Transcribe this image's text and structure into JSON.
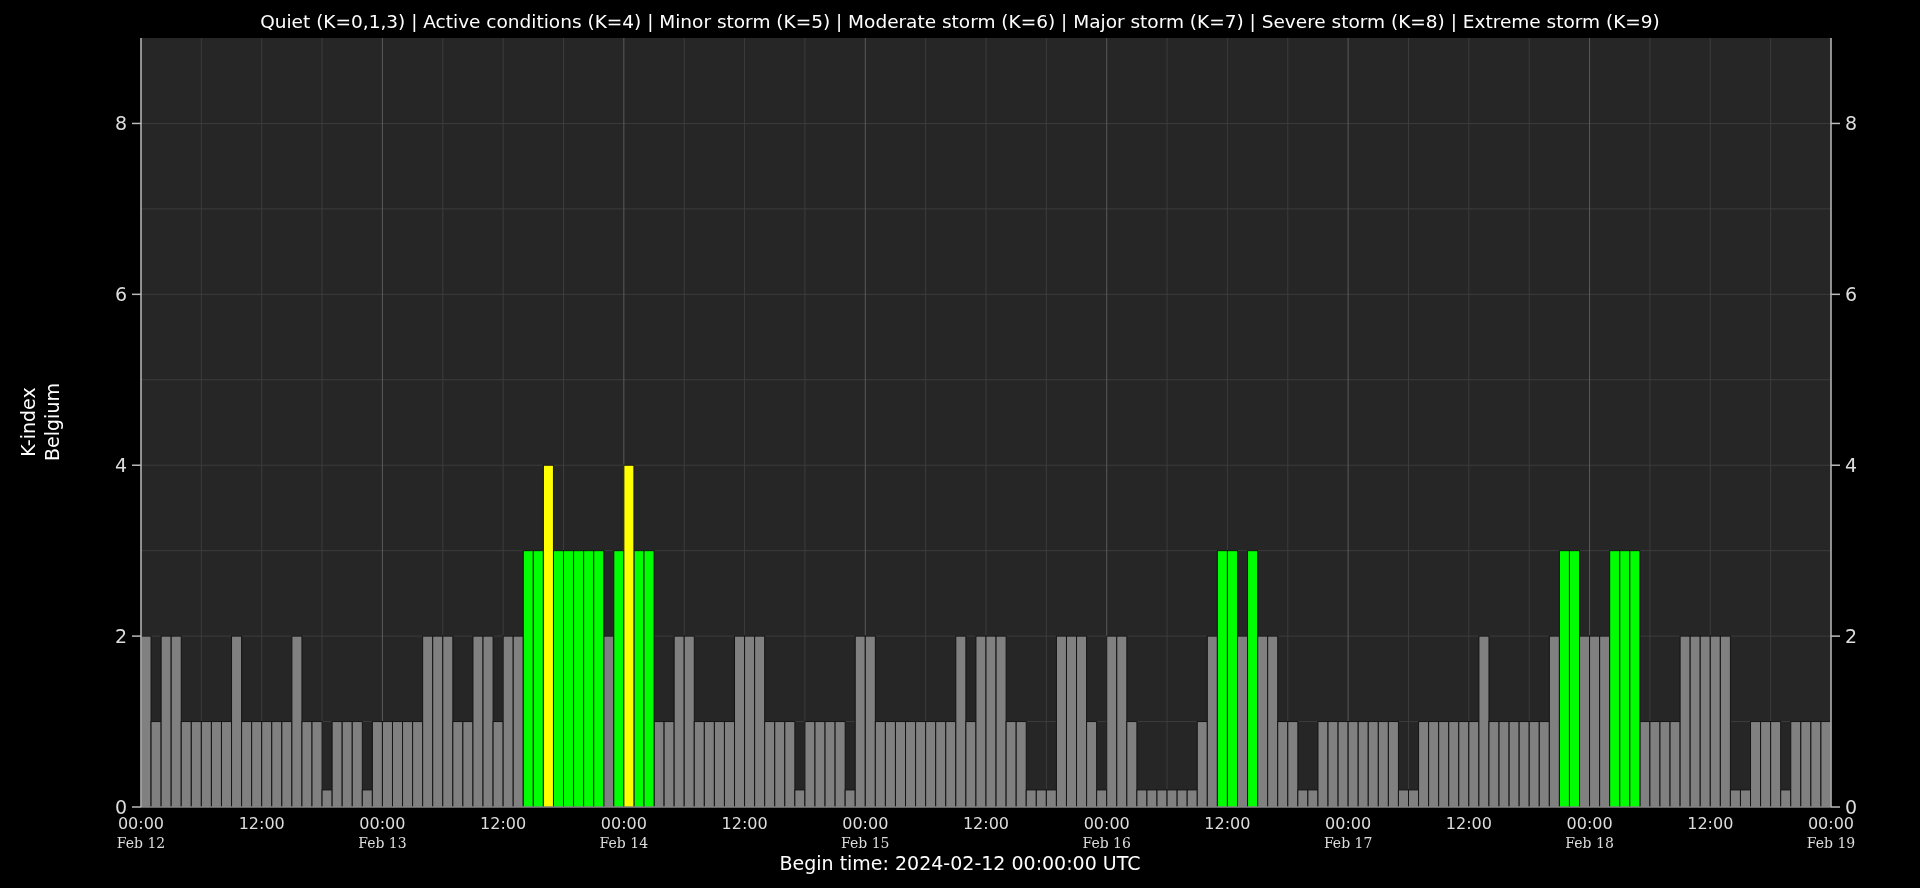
{
  "chart_data": {
    "type": "bar",
    "title": "Quiet (K=0,1,3) | Active conditions (K=4) | Minor storm (K=5) | Moderate storm (K=6) | Major storm (K=7) | Severe storm (K=8) | Extreme storm (K=9)",
    "xlabel": "Begin time: 2024-02-12 00:00:00 UTC",
    "ylabel": "K-index\nBelgium",
    "grid": true,
    "annotations": [
      "8",
      "6",
      "4",
      "2",
      "0"
    ],
    "xlim": [
      "2024-02-12 00:00",
      "2024-02-19 00:00"
    ],
    "ylim": [
      0,
      9
    ],
    "yticks": [
      0,
      2,
      4,
      6,
      8
    ],
    "xticks": [
      {
        "value": "2024-02-12 00:00",
        "label": "00:00\nFeb 12"
      },
      {
        "value": "2024-02-12 12:00",
        "label": "12:00"
      },
      {
        "value": "2024-02-13 00:00",
        "label": "00:00\nFeb 13"
      },
      {
        "value": "2024-02-13 12:00",
        "label": "12:00"
      },
      {
        "value": "2024-02-14 00:00",
        "label": "00:00\nFeb 14"
      },
      {
        "value": "2024-02-14 12:00",
        "label": "12:00"
      },
      {
        "value": "2024-02-15 00:00",
        "label": "00:00\nFeb 15"
      },
      {
        "value": "2024-02-15 12:00",
        "label": "12:00"
      },
      {
        "value": "2024-02-16 00:00",
        "label": "00:00\nFeb 16"
      },
      {
        "value": "2024-02-16 12:00",
        "label": "12:00"
      },
      {
        "value": "2024-02-17 00:00",
        "label": "00:00\nFeb 17"
      },
      {
        "value": "2024-02-17 12:00",
        "label": "12:00"
      },
      {
        "value": "2024-02-18 00:00",
        "label": "00:00\nFeb 18"
      },
      {
        "value": "2024-02-18 12:00",
        "label": "12:00"
      },
      {
        "value": "2024-02-19 00:00",
        "label": "00:00\nFeb 19"
      }
    ],
    "x": [
      "2024-02-12 00:00",
      "2024-02-12 01:00",
      "2024-02-12 02:00",
      "2024-02-12 03:00",
      "2024-02-12 04:00",
      "2024-02-12 05:00",
      "2024-02-12 06:00",
      "2024-02-12 07:00",
      "2024-02-12 08:00",
      "2024-02-12 09:00",
      "2024-02-12 10:00",
      "2024-02-12 11:00",
      "2024-02-12 12:00",
      "2024-02-12 13:00",
      "2024-02-12 14:00",
      "2024-02-12 15:00",
      "2024-02-12 16:00",
      "2024-02-12 17:00",
      "2024-02-12 18:00",
      "2024-02-12 19:00",
      "2024-02-12 20:00",
      "2024-02-12 21:00",
      "2024-02-12 22:00",
      "2024-02-12 23:00",
      "2024-02-13 00:00",
      "2024-02-13 01:00",
      "2024-02-13 02:00",
      "2024-02-13 03:00",
      "2024-02-13 04:00",
      "2024-02-13 05:00",
      "2024-02-13 06:00",
      "2024-02-13 07:00",
      "2024-02-13 08:00",
      "2024-02-13 09:00",
      "2024-02-13 10:00",
      "2024-02-13 11:00",
      "2024-02-13 12:00",
      "2024-02-13 13:00",
      "2024-02-13 14:00",
      "2024-02-13 15:00",
      "2024-02-13 16:00",
      "2024-02-13 17:00",
      "2024-02-13 18:00",
      "2024-02-13 19:00",
      "2024-02-13 20:00",
      "2024-02-13 21:00",
      "2024-02-13 22:00",
      "2024-02-13 23:00",
      "2024-02-14 00:00",
      "2024-02-14 01:00",
      "2024-02-14 02:00",
      "2024-02-14 03:00",
      "2024-02-14 04:00",
      "2024-02-14 05:00",
      "2024-02-14 06:00",
      "2024-02-14 07:00",
      "2024-02-14 08:00",
      "2024-02-14 09:00",
      "2024-02-14 10:00",
      "2024-02-14 11:00",
      "2024-02-14 12:00",
      "2024-02-14 13:00",
      "2024-02-14 14:00",
      "2024-02-14 15:00",
      "2024-02-14 16:00",
      "2024-02-14 17:00",
      "2024-02-14 18:00",
      "2024-02-14 19:00",
      "2024-02-14 20:00",
      "2024-02-14 21:00",
      "2024-02-14 22:00",
      "2024-02-14 23:00",
      "2024-02-15 00:00",
      "2024-02-15 01:00",
      "2024-02-15 02:00",
      "2024-02-15 03:00",
      "2024-02-15 04:00",
      "2024-02-15 05:00",
      "2024-02-15 06:00",
      "2024-02-15 07:00",
      "2024-02-15 08:00",
      "2024-02-15 09:00",
      "2024-02-15 10:00",
      "2024-02-15 11:00",
      "2024-02-15 12:00",
      "2024-02-15 13:00",
      "2024-02-15 14:00",
      "2024-02-15 15:00",
      "2024-02-15 16:00",
      "2024-02-15 17:00",
      "2024-02-15 18:00",
      "2024-02-15 19:00",
      "2024-02-15 20:00",
      "2024-02-15 21:00",
      "2024-02-15 22:00",
      "2024-02-15 23:00",
      "2024-02-16 00:00",
      "2024-02-16 01:00",
      "2024-02-16 02:00",
      "2024-02-16 03:00",
      "2024-02-16 04:00",
      "2024-02-16 05:00",
      "2024-02-16 06:00",
      "2024-02-16 07:00",
      "2024-02-16 08:00",
      "2024-02-16 09:00",
      "2024-02-16 10:00",
      "2024-02-16 11:00",
      "2024-02-16 12:00",
      "2024-02-16 13:00",
      "2024-02-16 14:00",
      "2024-02-16 15:00",
      "2024-02-16 16:00",
      "2024-02-16 17:00",
      "2024-02-16 18:00",
      "2024-02-16 19:00",
      "2024-02-16 20:00",
      "2024-02-16 21:00",
      "2024-02-16 22:00",
      "2024-02-16 23:00",
      "2024-02-17 00:00",
      "2024-02-17 01:00",
      "2024-02-17 02:00",
      "2024-02-17 03:00",
      "2024-02-17 04:00",
      "2024-02-17 05:00",
      "2024-02-17 06:00",
      "2024-02-17 07:00",
      "2024-02-17 08:00",
      "2024-02-17 09:00",
      "2024-02-17 10:00",
      "2024-02-17 11:00",
      "2024-02-17 12:00",
      "2024-02-17 13:00",
      "2024-02-17 14:00",
      "2024-02-17 15:00",
      "2024-02-17 16:00",
      "2024-02-17 17:00",
      "2024-02-17 18:00",
      "2024-02-17 19:00",
      "2024-02-17 20:00",
      "2024-02-17 21:00",
      "2024-02-17 22:00",
      "2024-02-17 23:00",
      "2024-02-18 00:00",
      "2024-02-18 01:00",
      "2024-02-18 02:00",
      "2024-02-18 03:00",
      "2024-02-18 04:00",
      "2024-02-18 05:00",
      "2024-02-18 06:00",
      "2024-02-18 07:00",
      "2024-02-18 08:00",
      "2024-02-18 09:00",
      "2024-02-18 10:00",
      "2024-02-18 11:00",
      "2024-02-18 12:00",
      "2024-02-18 13:00",
      "2024-02-18 14:00",
      "2024-02-18 15:00",
      "2024-02-18 16:00",
      "2024-02-18 17:00",
      "2024-02-18 18:00",
      "2024-02-18 19:00",
      "2024-02-18 20:00",
      "2024-02-18 21:00",
      "2024-02-18 22:00",
      "2024-02-18 23:00"
    ],
    "series": [
      {
        "color": "#808080",
        "values": [
          2,
          1,
          2,
          2,
          1,
          1,
          1,
          1,
          1,
          2,
          1,
          1,
          1,
          1,
          1,
          2,
          1,
          1,
          0.2,
          1,
          1,
          1,
          0.2,
          1,
          1,
          1,
          1,
          1,
          2,
          2,
          2,
          1,
          1,
          2,
          2,
          1,
          2,
          2,
          null,
          null,
          null,
          null,
          null,
          null,
          null,
          null,
          2,
          null,
          null,
          null,
          null,
          1,
          1,
          2,
          2,
          1,
          1,
          1,
          1,
          2,
          2,
          2,
          1,
          1,
          1,
          0.2,
          1,
          1,
          1,
          1,
          0.2,
          2,
          2,
          1,
          1,
          1,
          1,
          1,
          1,
          1,
          1,
          2,
          1,
          2,
          2,
          2,
          1,
          1,
          0.2,
          0.2,
          0.2,
          2,
          2,
          2,
          1,
          0.2,
          2,
          2,
          1,
          0.2,
          0.2,
          0.2,
          0.2,
          0.2,
          0.2,
          1,
          2,
          null,
          null,
          2,
          null,
          2,
          2,
          1,
          1,
          0.2,
          0.2,
          1,
          1,
          1,
          1,
          1,
          1,
          1,
          1,
          0.2,
          0.2,
          1,
          1,
          1,
          1,
          1,
          1,
          2,
          1,
          1,
          1,
          1,
          1,
          1,
          2,
          null,
          null,
          2,
          2,
          2,
          null,
          null,
          null,
          1,
          1,
          1,
          1,
          2,
          2,
          2,
          2,
          2,
          0.2,
          0.2,
          1,
          1,
          1,
          0.2,
          1,
          1,
          1,
          1
        ]
      },
      {
        "color": "#00ff00",
        "values": [
          null,
          null,
          null,
          null,
          null,
          null,
          null,
          null,
          null,
          null,
          null,
          null,
          null,
          null,
          null,
          null,
          null,
          null,
          null,
          null,
          null,
          null,
          null,
          null,
          null,
          null,
          null,
          null,
          null,
          null,
          null,
          null,
          null,
          null,
          null,
          null,
          null,
          null,
          3,
          3,
          null,
          3,
          3,
          3,
          3,
          3,
          null,
          3,
          null,
          3,
          3,
          null,
          null,
          null,
          null,
          null,
          null,
          null,
          null,
          null,
          null,
          null,
          null,
          null,
          null,
          null,
          null,
          null,
          null,
          null,
          null,
          null,
          null,
          null,
          null,
          null,
          null,
          null,
          null,
          null,
          null,
          null,
          null,
          null,
          null,
          null,
          null,
          null,
          null,
          null,
          null,
          null,
          null,
          null,
          null,
          null,
          null,
          null,
          null,
          null,
          null,
          null,
          null,
          null,
          null,
          null,
          null,
          3,
          3,
          null,
          3,
          null,
          null,
          null,
          null,
          null,
          null,
          null,
          null,
          null,
          null,
          null,
          null,
          null,
          null,
          null,
          null,
          null,
          null,
          null,
          null,
          null,
          null,
          null,
          null,
          null,
          null,
          null,
          null,
          null,
          null,
          3,
          3,
          null,
          null,
          null,
          3,
          3,
          3,
          null,
          null,
          null,
          null,
          null,
          null,
          null,
          null,
          null,
          null,
          null,
          null,
          null,
          null,
          null,
          null,
          null,
          null,
          null
        ]
      },
      {
        "color": "#ffff00",
        "values": [
          null,
          null,
          null,
          null,
          null,
          null,
          null,
          null,
          null,
          null,
          null,
          null,
          null,
          null,
          null,
          null,
          null,
          null,
          null,
          null,
          null,
          null,
          null,
          null,
          null,
          null,
          null,
          null,
          null,
          null,
          null,
          null,
          null,
          null,
          null,
          null,
          null,
          null,
          null,
          null,
          4,
          null,
          null,
          null,
          null,
          null,
          null,
          null,
          4,
          null,
          null,
          null,
          null,
          null,
          null,
          null,
          null,
          null,
          null,
          null,
          null,
          null,
          null,
          null,
          null,
          null,
          null,
          null,
          null,
          null,
          null,
          null,
          null,
          null,
          null,
          null,
          null,
          null,
          null,
          null,
          null,
          null,
          null,
          null,
          null,
          null,
          null,
          null,
          null,
          null,
          null,
          null,
          null,
          null,
          null,
          null,
          null,
          null,
          null,
          null,
          null,
          null,
          null,
          null,
          null,
          null,
          null,
          null,
          null,
          null,
          null,
          null,
          null,
          null,
          null,
          null,
          null,
          null,
          null,
          null,
          null,
          null,
          null,
          null,
          null,
          null,
          null,
          null,
          null,
          null,
          null,
          null,
          null,
          null,
          null,
          null,
          null,
          null,
          null,
          null,
          null,
          null,
          null,
          null,
          null,
          null,
          null,
          null,
          null,
          null,
          null,
          null,
          null,
          null,
          null,
          null,
          null,
          null,
          null,
          null,
          null,
          null,
          null,
          null,
          null,
          null,
          null,
          null
        ]
      }
    ]
  }
}
